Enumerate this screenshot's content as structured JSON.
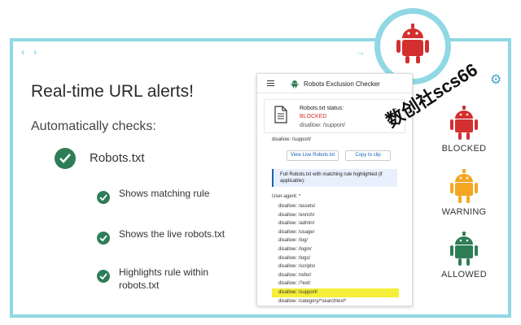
{
  "headline": "Real-time URL alerts!",
  "subheadline": "Automatically checks:",
  "main_item": "Robots.txt",
  "sub_items": [
    "Shows matching rule",
    "Shows the live robots.txt",
    "Highlights rule within robots.txt"
  ],
  "panel": {
    "title": "Robots Exclusion Checker",
    "status_label": "Robots.txt status:",
    "status_value": "BLOCKED",
    "status_rule": "disallow: /support/",
    "rule_line": "disallow: /support/",
    "view_button": "View Live Robots.txt",
    "copy_button": "Copy to clip",
    "info_text": "Full Robots.txt with matching rule highlighted (if applicable):",
    "user_agent": "User-agent: *",
    "rules": [
      "disallow: /assets/",
      "disallow: /enrich/",
      "disallow: /admin/",
      "disallow: /usage/",
      "disallow: /log/",
      "disallow: /login/",
      "disallow: /logs/",
      "disallow: /scripts/",
      "disallow: /refer/",
      "disallow: /?ext/",
      "disallow: /support/",
      "disallow: /category/*searchtext*"
    ],
    "highlighted_rule_index": 10
  },
  "badges": [
    {
      "label": "BLOCKED",
      "color": "#d32f2f"
    },
    {
      "label": "WARNING",
      "color": "#f5a623"
    },
    {
      "label": "ALLOWED",
      "color": "#2e7d57"
    }
  ],
  "watermark": "数创社scs66",
  "colors": {
    "frame": "#8fd8e4",
    "check": "#2e7d57",
    "blocked": "#d32f2f",
    "highlight": "#f5ef3a"
  },
  "icons": {
    "back": "chevron-left-icon",
    "forward": "chevron-right-icon",
    "menu": "hamburger-icon",
    "settings": "gear-icon",
    "robot": "android-robot-icon"
  }
}
